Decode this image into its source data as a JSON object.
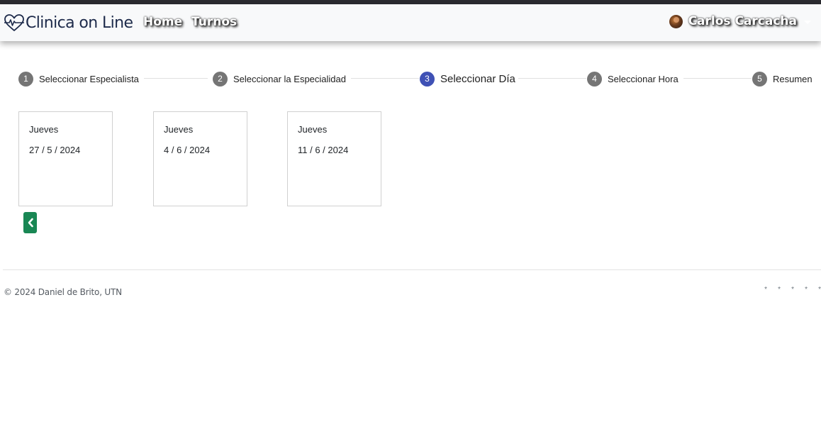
{
  "navbar": {
    "brand": "Clinica on Line",
    "links": [
      "Home",
      "Turnos"
    ],
    "user": "Carlos Carcacha"
  },
  "stepper": {
    "steps": [
      {
        "number": "1",
        "label": "Seleccionar Especialista"
      },
      {
        "number": "2",
        "label": "Seleccionar la Especialidad"
      },
      {
        "number": "3",
        "label": "Seleccionar Día"
      },
      {
        "number": "4",
        "label": "Seleccionar Hora"
      },
      {
        "number": "5",
        "label": "Resumen"
      }
    ],
    "active_step": 3
  },
  "days": [
    {
      "weekday": "Jueves",
      "date": "27 / 5 / 2024"
    },
    {
      "weekday": "Jueves",
      "date": "4 / 6 / 2024"
    },
    {
      "weekday": "Jueves",
      "date": "11 / 6 / 2024"
    }
  ],
  "back_button_icon": "chevron-left-icon",
  "footer": {
    "copyright": "© 2024 Daniel de Brito, UTN",
    "dots": [
      "*",
      "*",
      "*",
      "*",
      "*"
    ]
  },
  "colors": {
    "active_step": "#3f51b5",
    "inactive_step": "#757575",
    "back_button": "#198754",
    "brand_text": "#1d2a4a"
  }
}
